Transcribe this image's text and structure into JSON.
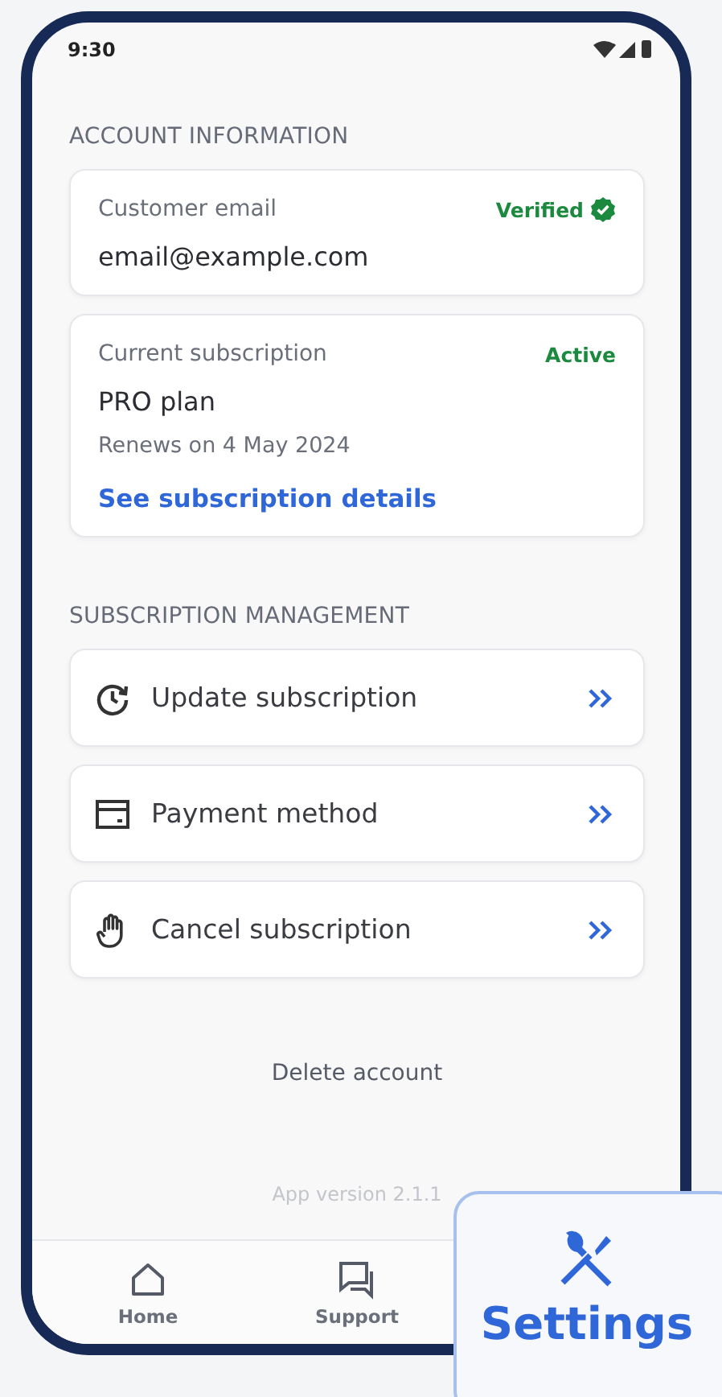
{
  "status_bar": {
    "time": "9:30"
  },
  "sections": [
    {
      "title": "ACCOUNT INFORMATION"
    },
    {
      "title": "SUBSCRIPTION MANAGEMENT"
    }
  ],
  "email_card": {
    "label": "Customer email",
    "badge": "Verified",
    "value": "email@example.com"
  },
  "subscription_card": {
    "label": "Current subscription",
    "badge": "Active",
    "plan": "PRO plan",
    "renewal": "Renews on 4 May 2024",
    "link": "See subscription details"
  },
  "actions": [
    {
      "kind": "update",
      "label": "Update subscription"
    },
    {
      "kind": "payment",
      "label": "Payment method"
    },
    {
      "kind": "cancel",
      "label": "Cancel subscription"
    }
  ],
  "delete_link": "Delete account",
  "app_version": "App version 2.1.1",
  "nav": [
    {
      "kind": "home",
      "label": "Home",
      "selected": false
    },
    {
      "kind": "support",
      "label": "Support",
      "selected": false
    },
    {
      "kind": "settings",
      "label": "Settings",
      "selected": true
    }
  ]
}
